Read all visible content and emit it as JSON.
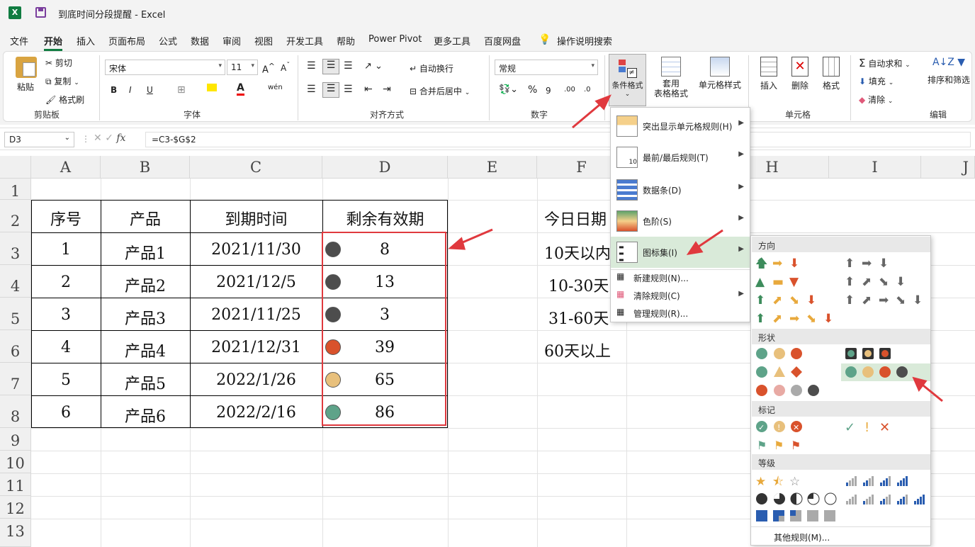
{
  "window": {
    "title": "到底时间分段提醒  -  Excel",
    "app_icon": "X"
  },
  "tabs": [
    "文件",
    "开始",
    "插入",
    "页面布局",
    "公式",
    "数据",
    "审阅",
    "视图",
    "开发工具",
    "帮助",
    "Power Pivot",
    "更多工具",
    "百度网盘",
    "操作说明搜索"
  ],
  "active_tab": "开始",
  "ribbon": {
    "clipboard": {
      "paste": "粘贴",
      "cut": "剪切",
      "copy": "复制",
      "format_painter": "格式刷",
      "group": "剪贴板"
    },
    "font": {
      "name": "宋体",
      "size": "11",
      "bold": "B",
      "italic": "I",
      "underline": "U",
      "group": "字体"
    },
    "alignment": {
      "wrap": "自动换行",
      "merge": "合并后居中",
      "group": "对齐方式"
    },
    "number": {
      "format": "常规",
      "percent": "%",
      "group": "数字"
    },
    "styles": {
      "conditional": "条件格式",
      "table": "套用\n表格格式",
      "cell_styles": "单元格样式"
    },
    "cells": {
      "insert": "插入",
      "delete": "删除",
      "format": "格式",
      "group": "单元格"
    },
    "editing": {
      "autosum": "自动求和",
      "fill": "填充",
      "clear": "清除",
      "sort": "排序和筛选",
      "group": "编辑"
    }
  },
  "formula_bar": {
    "name_box": "D3",
    "formula": "=C3-$G$2",
    "fx": "fx"
  },
  "columns": [
    "A",
    "B",
    "C",
    "D",
    "E",
    "F",
    "G",
    "H",
    "I",
    "J"
  ],
  "rows": [
    "1",
    "2",
    "3",
    "4",
    "5",
    "6",
    "7",
    "8",
    "9",
    "10",
    "11",
    "12",
    "13"
  ],
  "table": {
    "headers": [
      "序号",
      "产品",
      "到期时间",
      "剩余有效期"
    ],
    "rows": [
      {
        "no": "1",
        "product": "产品1",
        "date": "2021/11/30",
        "days": "8",
        "icon_color": "#4d4d4d"
      },
      {
        "no": "2",
        "product": "产品2",
        "date": "2021/12/5",
        "days": "13",
        "icon_color": "#4d4d4d"
      },
      {
        "no": "3",
        "product": "产品3",
        "date": "2021/11/25",
        "days": "3",
        "icon_color": "#4d4d4d"
      },
      {
        "no": "4",
        "product": "产品4",
        "date": "2021/12/31",
        "days": "39",
        "icon_color": "#d9522c"
      },
      {
        "no": "5",
        "product": "产品5",
        "date": "2022/1/26",
        "days": "65",
        "icon_color": "#e8c07c"
      },
      {
        "no": "6",
        "product": "产品6",
        "date": "2022/2/16",
        "days": "86",
        "icon_color": "#5ea389"
      }
    ]
  },
  "f_column": [
    "今日日期",
    "10天以内",
    "10-30天",
    "31-60天",
    "60天以上"
  ],
  "cf_menu": {
    "items": [
      "突出显示单元格规则(H)",
      "最前/最后规则(T)",
      "数据条(D)",
      "色阶(S)",
      "图标集(I)"
    ],
    "small_items": [
      "新建规则(N)...",
      "清除规则(C)",
      "管理规则(R)..."
    ]
  },
  "iconset_menu": {
    "sections": [
      "方向",
      "形状",
      "标记",
      "等级"
    ],
    "more": "其他规则(M)..."
  }
}
